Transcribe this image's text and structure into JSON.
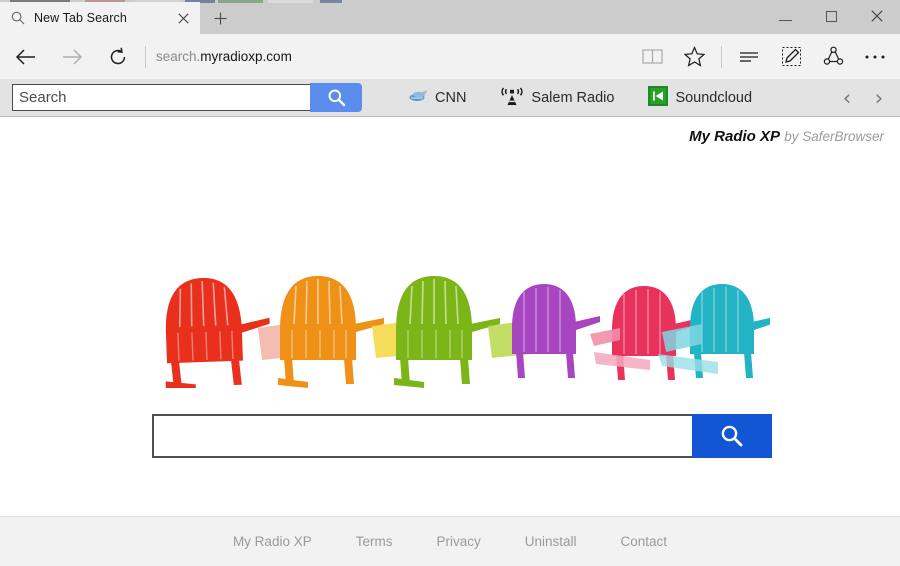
{
  "window": {
    "controls": {
      "minimize": "minimize-button",
      "maximize": "maximize-button",
      "close": "close-button"
    }
  },
  "tabs": {
    "items": [
      {
        "title": "New Tab Search",
        "favicon": "search-icon",
        "active": true
      }
    ],
    "new_tab_label": "+",
    "close_label": "×"
  },
  "navbar": {
    "back": "back-arrow-icon",
    "forward": "forward-arrow-icon",
    "refresh": "refresh-icon",
    "url_prefix": "search.",
    "url_domain": "myradioxp.com",
    "url_full": "search.myradioxp.com",
    "actions": [
      {
        "name": "reading-view-icon",
        "title": "Reading view"
      },
      {
        "name": "favorites-star-icon",
        "title": "Add to favorites"
      },
      {
        "name": "hub-icon",
        "title": "Hub"
      },
      {
        "name": "web-note-icon",
        "title": "Make a Web Note"
      },
      {
        "name": "share-icon",
        "title": "Share"
      },
      {
        "name": "more-icon",
        "title": "More"
      }
    ]
  },
  "ext_toolbar": {
    "search_placeholder": "Search",
    "search_value": "",
    "search_button_icon": "search-icon",
    "search_button_color": "#5b8def",
    "links": [
      {
        "label": "CNN",
        "icon": "cnn-icon"
      },
      {
        "label": "Salem Radio",
        "icon": "broadcast-antenna-icon"
      },
      {
        "label": "Soundcloud",
        "icon": "soundcloud-icon"
      }
    ],
    "prev_arrow": "‹",
    "next_arrow": "›"
  },
  "content": {
    "brand_name": "My Radio XP",
    "brand_by": "by SaferBrowser",
    "hero_alt": "colorful-adirondack-chairs",
    "hero_chair_colors": [
      "#e8301c",
      "#ef9116",
      "#7cb518",
      "#a746c0",
      "#e8325c",
      "#22b3c4"
    ],
    "search_value": "",
    "search_placeholder": "",
    "search_button_icon": "search-icon",
    "search_button_color": "#1256d6"
  },
  "footer": {
    "links": [
      {
        "label": "My Radio XP"
      },
      {
        "label": "Terms"
      },
      {
        "label": "Privacy"
      },
      {
        "label": "Uninstall"
      },
      {
        "label": "Contact"
      }
    ]
  }
}
